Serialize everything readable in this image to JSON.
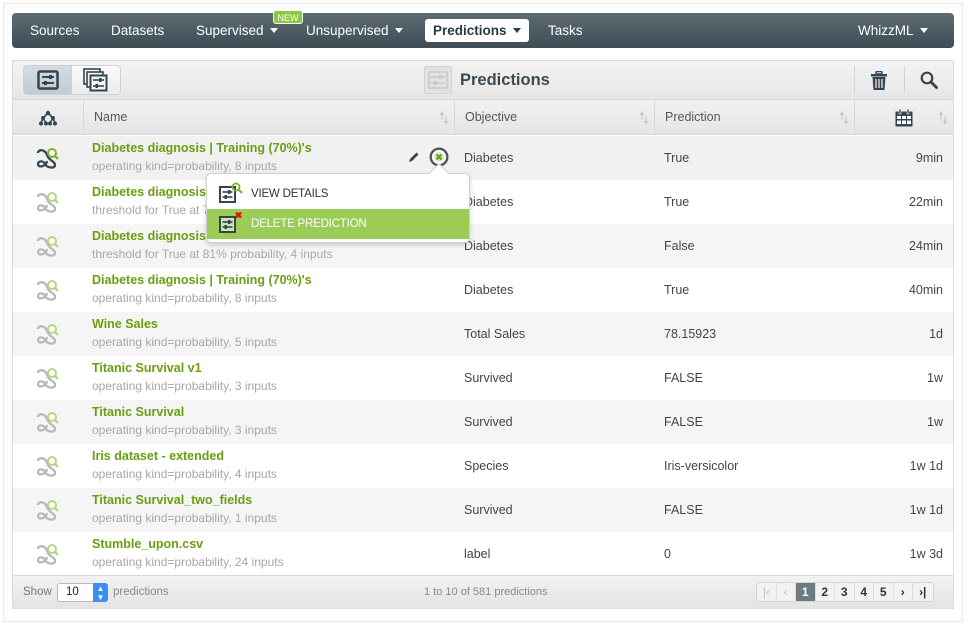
{
  "nav": {
    "items": [
      {
        "label": "Sources",
        "dropdown": false
      },
      {
        "label": "Datasets",
        "dropdown": false
      },
      {
        "label": "Supervised",
        "dropdown": true,
        "badge": "NEW"
      },
      {
        "label": "Unsupervised",
        "dropdown": true
      },
      {
        "label": "Predictions",
        "dropdown": true,
        "active": true
      },
      {
        "label": "Tasks",
        "dropdown": false
      }
    ],
    "right": {
      "label": "WhizzML",
      "dropdown": true
    }
  },
  "toolbar": {
    "title": "Predictions",
    "view_toggle": [
      "single-predictions-view",
      "batch-predictions-view"
    ],
    "actions": [
      "delete-icon",
      "search-icon"
    ]
  },
  "table": {
    "columns": [
      {
        "key": "type",
        "label": "",
        "icon": "model-tree-icon"
      },
      {
        "key": "name",
        "label": "Name"
      },
      {
        "key": "objective",
        "label": "Objective"
      },
      {
        "key": "prediction",
        "label": "Prediction"
      },
      {
        "key": "age",
        "label": "",
        "icon": "calendar-icon"
      }
    ],
    "rows": [
      {
        "name": "Diabetes diagnosis | Training (70%)'s",
        "sub": "operating kind=probability, 8 inputs",
        "objective": "Diabetes",
        "prediction": "True",
        "age": "9min"
      },
      {
        "name": "Diabetes diagnosis | Training (70%)'s",
        "sub": "threshold for True at 70% probability, 4 inputs",
        "objective": "Diabetes",
        "prediction": "True",
        "age": "22min"
      },
      {
        "name": "Diabetes diagnosis | Training (70%)'s",
        "sub": "threshold for True at 81% probability, 4 inputs",
        "objective": "Diabetes",
        "prediction": "False",
        "age": "24min"
      },
      {
        "name": "Diabetes diagnosis | Training (70%)'s",
        "sub": "operating kind=probability, 8 inputs",
        "objective": "Diabetes",
        "prediction": "True",
        "age": "40min"
      },
      {
        "name": "Wine Sales",
        "sub": "operating kind=probability, 5 inputs",
        "objective": "Total Sales",
        "prediction": "78.15923",
        "age": "1d"
      },
      {
        "name": "Titanic Survival v1",
        "sub": "operating kind=probability, 3 inputs",
        "objective": "Survived",
        "prediction": "FALSE",
        "age": "1w"
      },
      {
        "name": "Titanic Survival",
        "sub": "operating kind=probability, 3 inputs",
        "objective": "Survived",
        "prediction": "FALSE",
        "age": "1w"
      },
      {
        "name": "Iris dataset - extended",
        "sub": "operating kind=probability, 4 inputs",
        "objective": "Species",
        "prediction": "Iris-versicolor",
        "age": "1w 1d"
      },
      {
        "name": "Titanic Survival_two_fields",
        "sub": "operating kind=probability, 1 inputs",
        "objective": "Survived",
        "prediction": "FALSE",
        "age": "1w 1d"
      },
      {
        "name": "Stumble_upon.csv",
        "sub": "operating kind=probability, 24 inputs",
        "objective": "label",
        "prediction": "0",
        "age": "1w 3d"
      }
    ]
  },
  "context_menu": {
    "items": [
      {
        "label": "VIEW DETAILS",
        "icon": "view-details-icon"
      },
      {
        "label": "DELETE PREDICTION",
        "icon": "delete-prediction-icon",
        "highlighted": true
      }
    ]
  },
  "footer": {
    "show_label": "Show",
    "page_size": "10",
    "per_label": "predictions",
    "range_text": "1 to 10 of 581 predictions",
    "pages": [
      "1",
      "2",
      "3",
      "4",
      "5"
    ],
    "current_page": "1"
  },
  "colors": {
    "accent_green": "#8dc63f",
    "link_green": "#6a9e12",
    "nav_dark": "#3d4c55",
    "menu_highlight": "#9ccc58"
  }
}
